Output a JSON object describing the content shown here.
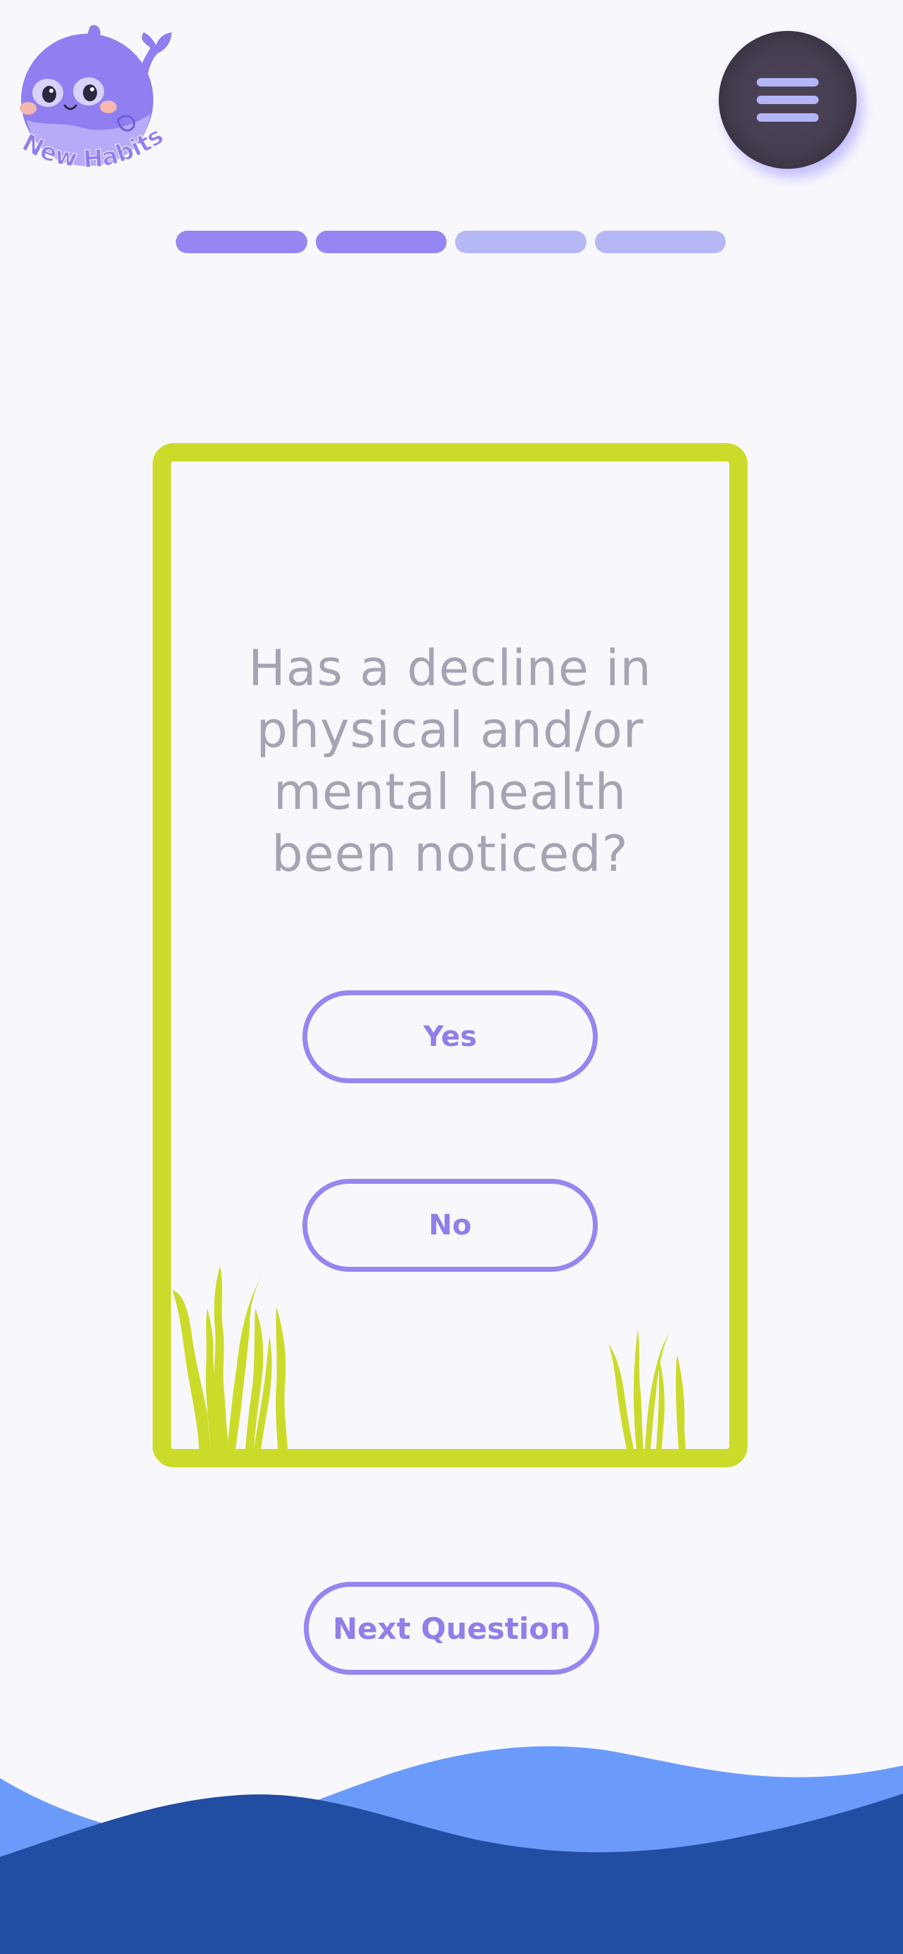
{
  "brand": {
    "app_name": "New Habits",
    "logo_icon": "whale-mascot-icon"
  },
  "menu": {
    "icon": "hamburger-menu-icon"
  },
  "progress": {
    "total_steps": 4,
    "completed_steps": 2,
    "segments": [
      {
        "state": "complete",
        "color": "#9586f2"
      },
      {
        "state": "complete",
        "color": "#9586f2"
      },
      {
        "state": "pending",
        "color": "#b6b8f6"
      },
      {
        "state": "pending",
        "color": "#b6b8f6"
      }
    ]
  },
  "card": {
    "question": "Has a decline in physical and/or mental health been noticed?",
    "options": [
      {
        "label": "Yes"
      },
      {
        "label": "No"
      }
    ]
  },
  "footer": {
    "next_label": "Next Question"
  },
  "colors": {
    "accent": "#9586f2",
    "card_border": "#cbdb2a",
    "question_text": "#a7a3b3",
    "background": "#f8f8fc",
    "wave_light": "#6b9bfa",
    "wave_dark": "#214da3",
    "menu_button": "#4a4054"
  }
}
